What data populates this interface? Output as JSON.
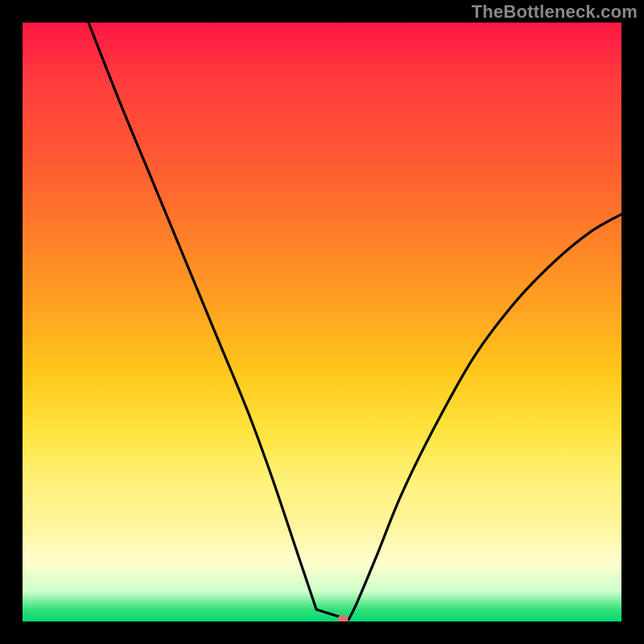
{
  "watermark_text": "TheBottleneck.com",
  "colors": {
    "background": "#000000",
    "curve_stroke": "#000000",
    "marker_fill": "#d1776d",
    "watermark_color": "#888888",
    "gradient_stops": [
      {
        "pct": 0,
        "hex": "#ff1744"
      },
      {
        "pct": 10,
        "hex": "#ff3d3d"
      },
      {
        "pct": 22,
        "hex": "#ff5733"
      },
      {
        "pct": 34,
        "hex": "#ff7a2a"
      },
      {
        "pct": 46,
        "hex": "#ff9e22"
      },
      {
        "pct": 58,
        "hex": "#ffc61a"
      },
      {
        "pct": 68,
        "hex": "#ffe33d"
      },
      {
        "pct": 76,
        "hex": "#fff176"
      },
      {
        "pct": 84,
        "hex": "#fff59d"
      },
      {
        "pct": 90,
        "hex": "#ffffcc"
      },
      {
        "pct": 95,
        "hex": "#ccffcc"
      },
      {
        "pct": 98,
        "hex": "#33e07a"
      },
      {
        "pct": 100,
        "hex": "#00d973"
      }
    ]
  },
  "chart_data": {
    "type": "line",
    "title": "",
    "xlabel": "",
    "ylabel": "",
    "x_range": [
      0,
      744
    ],
    "y_range_bottleneck_pct": [
      0,
      100
    ],
    "vertex": {
      "x": 395,
      "y_pct": 0
    },
    "flat_segment_x": [
      365,
      405
    ],
    "marker": {
      "x": 398,
      "y_pct": 0
    },
    "series": [
      {
        "name": "bottleneck-curve",
        "comment": "V-shaped curve. y values are estimated bottleneck % (100 = top of plot, 0 = bottom). x is pixel position within 744px plot width.",
        "points": [
          {
            "x": 82,
            "y": 100
          },
          {
            "x": 120,
            "y": 87
          },
          {
            "x": 160,
            "y": 74
          },
          {
            "x": 200,
            "y": 61
          },
          {
            "x": 240,
            "y": 48
          },
          {
            "x": 280,
            "y": 35
          },
          {
            "x": 310,
            "y": 24
          },
          {
            "x": 340,
            "y": 12
          },
          {
            "x": 365,
            "y": 2
          },
          {
            "x": 375,
            "y": 0.3
          },
          {
            "x": 395,
            "y": 0.3
          },
          {
            "x": 405,
            "y": 0.3
          },
          {
            "x": 415,
            "y": 3
          },
          {
            "x": 440,
            "y": 11
          },
          {
            "x": 470,
            "y": 21
          },
          {
            "x": 510,
            "y": 32
          },
          {
            "x": 560,
            "y": 44
          },
          {
            "x": 610,
            "y": 53
          },
          {
            "x": 660,
            "y": 60
          },
          {
            "x": 705,
            "y": 65
          },
          {
            "x": 744,
            "y": 68
          }
        ]
      }
    ]
  }
}
